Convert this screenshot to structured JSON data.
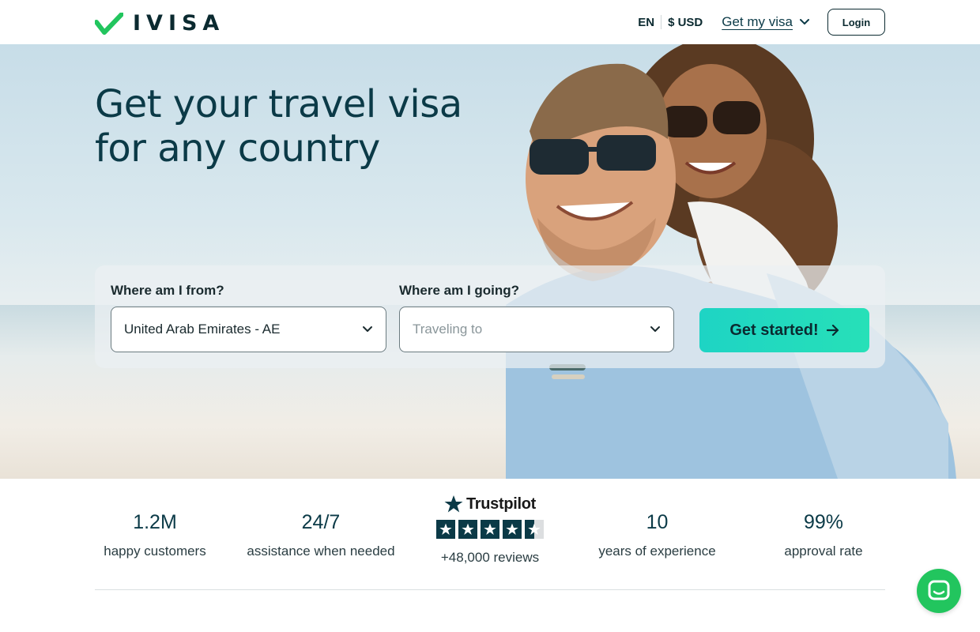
{
  "header": {
    "logo_text": "IVISA",
    "language": "EN",
    "currency": "$ USD",
    "get_visa_label": "Get my visa",
    "login_label": "Login"
  },
  "hero": {
    "title_line1": "Get your travel visa",
    "title_line2": "for any country"
  },
  "search": {
    "from_label": "Where am I from?",
    "from_value": "United Arab Emirates - AE",
    "to_label": "Where am I going?",
    "to_placeholder": "Traveling to",
    "cta_label": "Get started!"
  },
  "stats": [
    {
      "value": "1.2M",
      "label": "happy customers"
    },
    {
      "value": "24/7",
      "label": "assistance when needed"
    },
    {
      "value": "10",
      "label": "years of experience"
    },
    {
      "value": "99%",
      "label": "approval rate"
    }
  ],
  "trustpilot": {
    "brand": "Trustpilot",
    "rating_stars": 4.5,
    "reviews": "+48,000 reviews"
  },
  "colors": {
    "brand_green": "#22c55e",
    "cta_gradient_start": "#1ed4c4",
    "cta_gradient_end": "#27e0b8",
    "text_dark": "#0b3a47"
  },
  "icons": {
    "logo": "checkmark-logo-icon",
    "dropdown": "chevron-down-icon",
    "cta": "arrow-right-icon",
    "trustpilot": "star-icon",
    "chat": "chat-bubble-icon"
  }
}
